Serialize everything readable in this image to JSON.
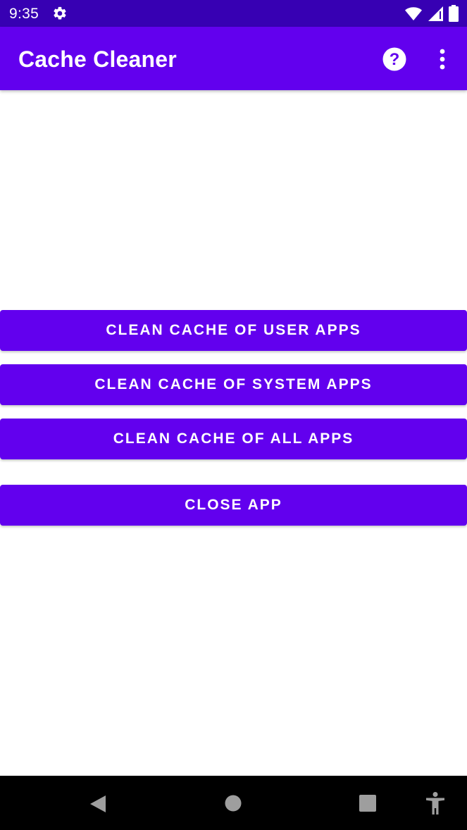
{
  "status_bar": {
    "time": "9:35",
    "icons": [
      "settings-gear-icon",
      "wifi-icon",
      "cellular-signal-icon",
      "battery-icon"
    ]
  },
  "app_bar": {
    "title": "Cache Cleaner",
    "actions": [
      "help-icon",
      "more-vert-icon"
    ]
  },
  "buttons": {
    "clean_user": "CLEAN CACHE OF USER APPS",
    "clean_system": "CLEAN CACHE OF SYSTEM APPS",
    "clean_all": "CLEAN CACHE OF ALL APPS",
    "close": "CLOSE APP"
  },
  "nav_bar": {
    "icons": [
      "back-icon",
      "home-icon",
      "recents-icon",
      "accessibility-icon"
    ]
  },
  "colors": {
    "status_bar": "#3700b3",
    "primary": "#6200ee",
    "background": "#ffffff",
    "nav_bar": "#000000"
  }
}
